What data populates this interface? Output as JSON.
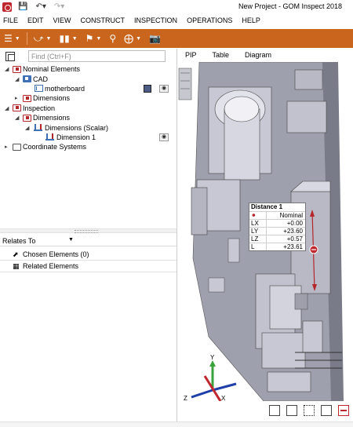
{
  "window": {
    "title": "New Project - GOM Inspect 2018"
  },
  "menu": {
    "items": [
      "FILE",
      "EDIT",
      "VIEW",
      "CONSTRUCT",
      "INSPECTION",
      "OPERATIONS",
      "HELP"
    ]
  },
  "toolbar": {
    "icons": [
      "hamburger-menu-icon",
      "sequence-icon",
      "bar-chart-icon",
      "flag-icon",
      "search-icon",
      "crosshair-icon",
      "camera-icon"
    ]
  },
  "explorer": {
    "search_placeholder": "Find (Ctrl+F)",
    "tree": {
      "nominal_elements": "Nominal Elements",
      "cad": "CAD",
      "motherboard": "motherboard",
      "nominal_dimensions": "Dimensions",
      "inspection": "Inspection",
      "inspection_dimensions": "Dimensions",
      "dimensions_scalar": "Dimensions (Scalar)",
      "dimension_1": "Dimension 1",
      "coordinate_systems": "Coordinate Systems"
    },
    "motherboard_color": "#4d5b87"
  },
  "relates": {
    "header": "Relates To",
    "chosen_elements": "Chosen Elements (0)",
    "related_elements": "Related Elements"
  },
  "view": {
    "tabs": [
      "PIP",
      "Table",
      "Diagram"
    ],
    "distance_label": {
      "title": "Distance 1",
      "nominal_header": "Nominal",
      "rows": [
        {
          "key": "LX",
          "value": "+0.00"
        },
        {
          "key": "LY",
          "value": "+23.60"
        },
        {
          "key": "LZ",
          "value": "+0.57"
        },
        {
          "key": "L",
          "value": "+23.61"
        }
      ]
    },
    "axes": {
      "x": "X",
      "y": "Y",
      "z": "Z"
    }
  },
  "colors": {
    "accent": "#c9651c",
    "brand_red": "#c0262d",
    "part_gray": "#b9b9c4"
  }
}
